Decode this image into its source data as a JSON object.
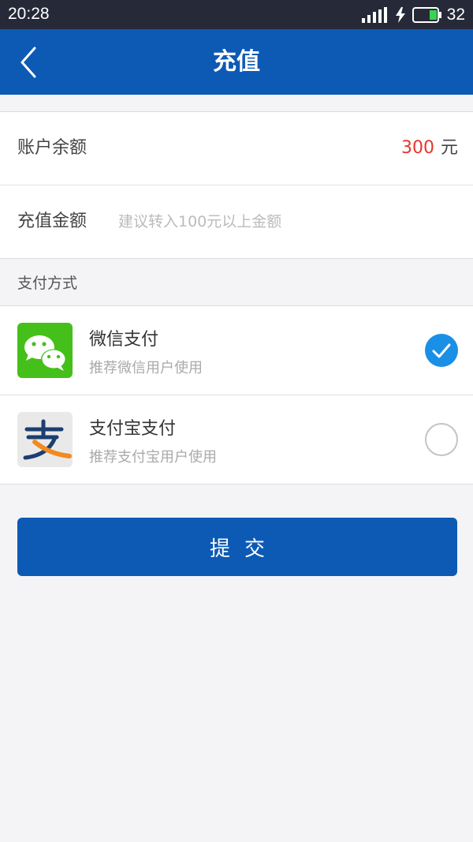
{
  "status_bar": {
    "time": "20:28",
    "battery_level": "32"
  },
  "header": {
    "title": "充值",
    "back_icon": "chevron-left-icon"
  },
  "account": {
    "balance_label": "账户余额",
    "balance_value": "300",
    "balance_unit": "元",
    "amount_label": "充值金额",
    "amount_placeholder": "建议转入100元以上金额",
    "amount_value": ""
  },
  "payment": {
    "section_label": "支付方式",
    "methods": [
      {
        "title": "微信支付",
        "subtitle": "推荐微信用户使用",
        "icon": "wechat-icon",
        "selected": true
      },
      {
        "title": "支付宝支付",
        "subtitle": "推荐支付宝用户使用",
        "icon": "alipay-icon",
        "selected": false
      }
    ]
  },
  "submit_label": "提交",
  "colors": {
    "primary": "#0d5ab5",
    "status_bar": "#262a38",
    "balance_highlight": "#e8352e",
    "checked": "#1a8fe6",
    "wechat_green": "#45c01a",
    "alipay_blue": "#1c3e70",
    "alipay_orange": "#f28a1e"
  }
}
